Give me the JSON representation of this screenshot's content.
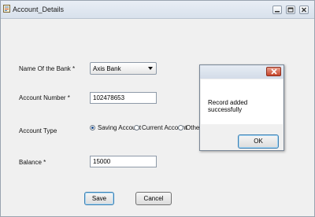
{
  "window": {
    "title": "Account_Details"
  },
  "form": {
    "bank_label": "Name Of the Bank *",
    "bank_value": "Axis Bank",
    "account_number_label": "Account Number *",
    "account_number_value": "102478653",
    "account_type_label": "Account Type",
    "account_type_options": [
      "Saving Account",
      "Current Account",
      "Other"
    ],
    "account_type_selected": "Saving Account",
    "balance_label": "Balance *",
    "balance_value": "15000",
    "save_label": "Save",
    "cancel_label": "Cancel"
  },
  "message_box": {
    "text": "Record added successfully",
    "ok_label": "OK"
  },
  "colors": {
    "window_bg": "#f0f0f0",
    "close_red": "#c8462b",
    "default_button_border": "#3c7fb1"
  }
}
